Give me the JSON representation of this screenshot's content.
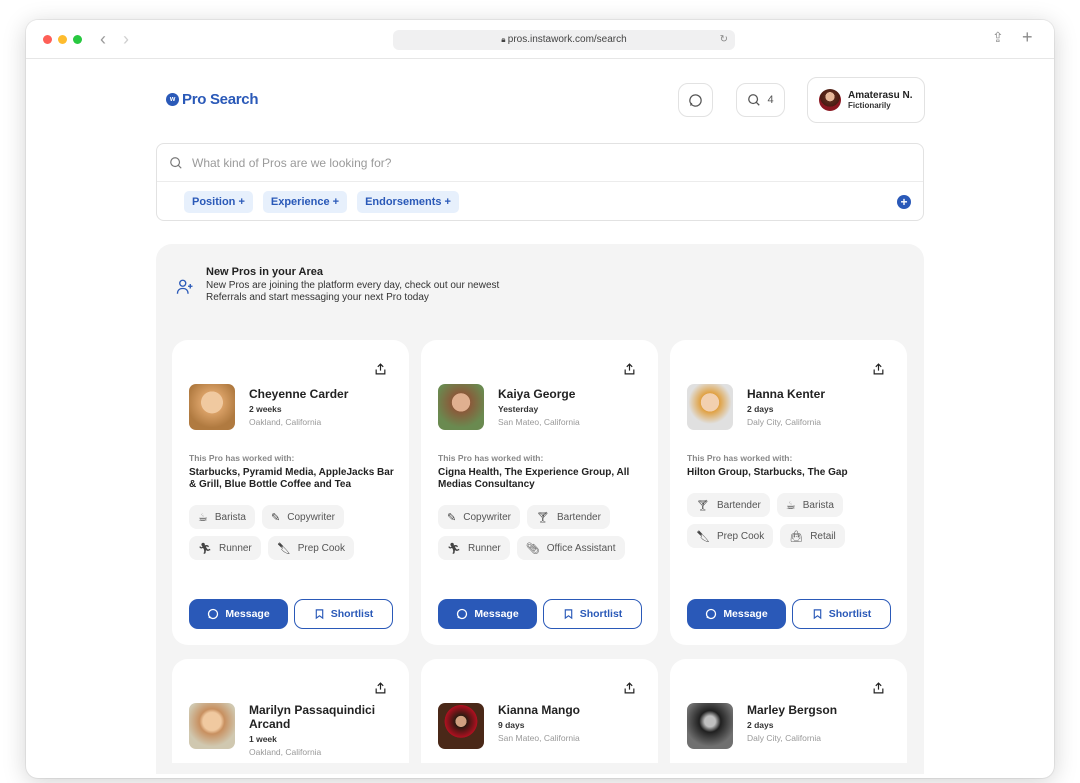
{
  "browser": {
    "url": "pros.instawork.com/search"
  },
  "header": {
    "logo": "Pro Search",
    "search_count": "4",
    "user_name": "Amaterasu N.",
    "user_company": "Fictionarily"
  },
  "search": {
    "placeholder": "What kind of Pros are we looking for?",
    "filters": [
      "Position +",
      "Experience +",
      "Endorsements +"
    ]
  },
  "section": {
    "title": "New Pros in your Area",
    "description": "New Pros are joining the platform every day, check out our newest Referrals and start messaging your next Pro today"
  },
  "labels": {
    "worked_with": "This Pro has worked with:",
    "message": "Message",
    "shortlist": "Shortlist"
  },
  "pros": [
    {
      "name": "Cheyenne Carder",
      "time": "2 weeks",
      "location": "Oakland, California",
      "companies": "Starbucks, Pyramid Media, AppleJacks Bar & Grill, Blue Bottle Coffee and Tea",
      "tags": [
        {
          "label": "Barista",
          "icon": "coffee-icon"
        },
        {
          "label": "Copywriter",
          "icon": "feather-icon"
        },
        {
          "label": "Runner",
          "icon": "runner-icon"
        },
        {
          "label": "Prep Cook",
          "icon": "knife-icon"
        }
      ]
    },
    {
      "name": "Kaiya George",
      "time": "Yesterday",
      "location": "San Mateo, California",
      "companies": "Cigna Health, The Experience Group, All Medias Consultancy",
      "tags": [
        {
          "label": "Copywriter",
          "icon": "feather-icon"
        },
        {
          "label": "Bartender",
          "icon": "cocktail-icon"
        },
        {
          "label": "Runner",
          "icon": "runner-icon"
        },
        {
          "label": "Office Assistant",
          "icon": "paperclip-icon"
        }
      ]
    },
    {
      "name": "Hanna Kenter",
      "time": "2 days",
      "location": "Daly City, California",
      "companies": "Hilton Group, Starbucks, The Gap",
      "tags": [
        {
          "label": "Bartender",
          "icon": "cocktail-icon"
        },
        {
          "label": "Barista",
          "icon": "coffee-icon"
        },
        {
          "label": "Prep Cook",
          "icon": "knife-icon"
        },
        {
          "label": "Retail",
          "icon": "bag-icon"
        }
      ]
    },
    {
      "name": "Marilyn Passaquindici Arcand",
      "time": "1 week",
      "location": "Oakland, California"
    },
    {
      "name": "Kianna Mango",
      "time": "9 days",
      "location": "San Mateo, California"
    },
    {
      "name": "Marley Bergson",
      "time": "2 days",
      "location": "Daly City, California"
    }
  ]
}
